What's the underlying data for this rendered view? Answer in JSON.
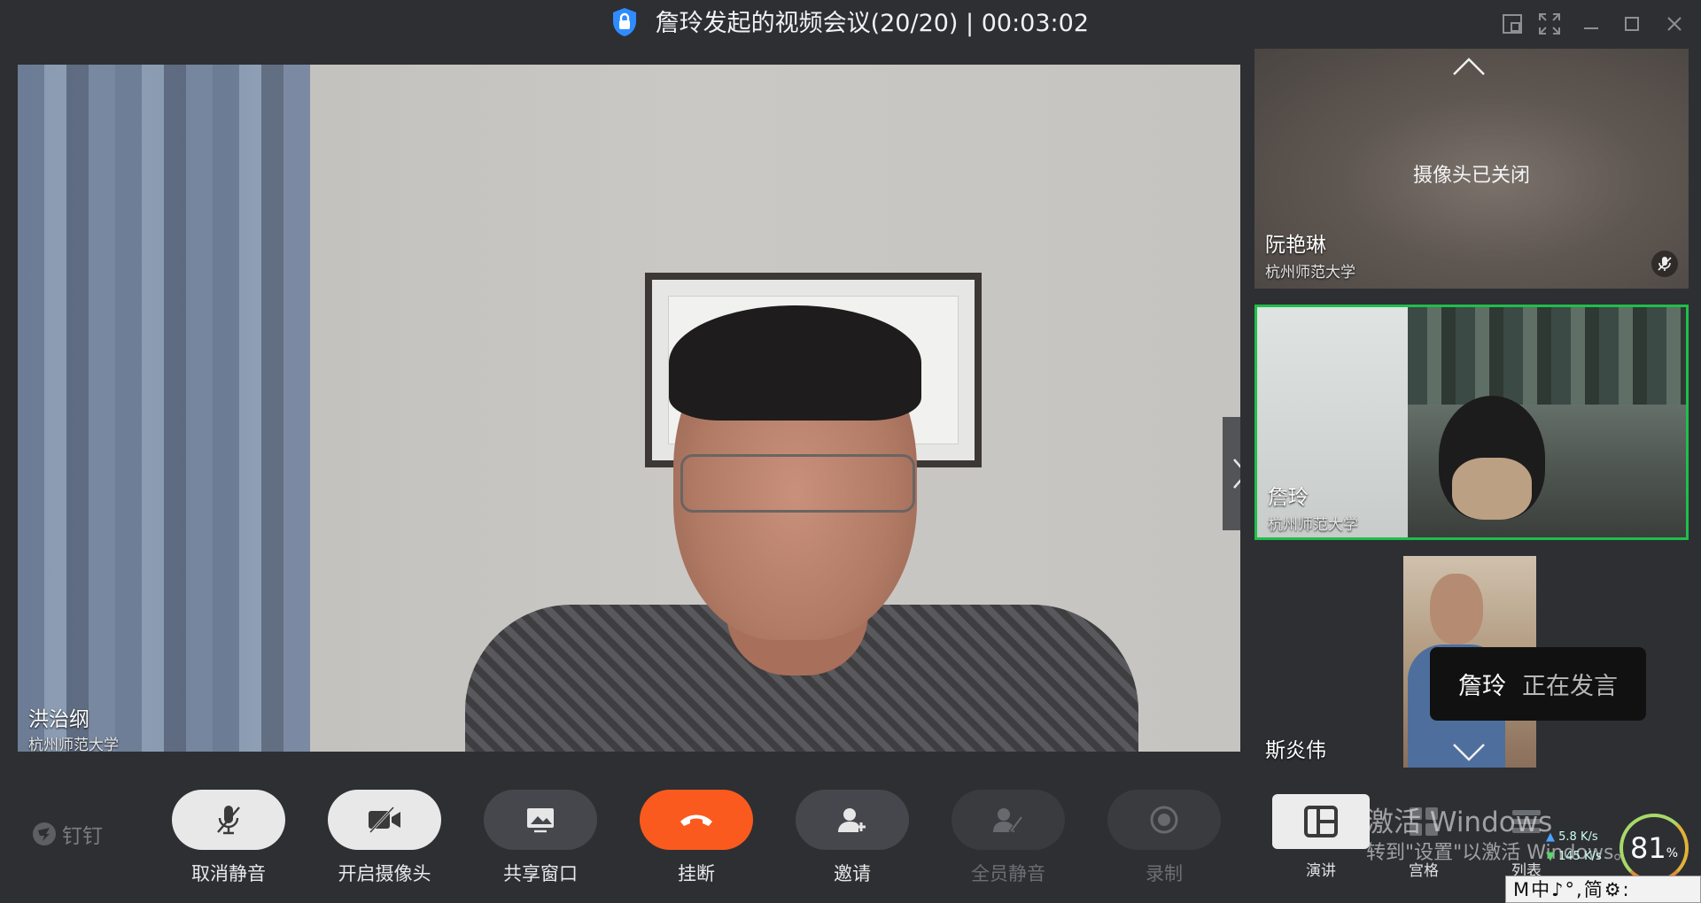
{
  "window": {
    "title": "詹玲发起的视频会议(20/20) | 00:03:02"
  },
  "main_video": {
    "name": "洪治纲",
    "org": "杭州师范大学"
  },
  "participants": [
    {
      "name": "阮艳琳",
      "org": "杭州师范大学",
      "camera_status": "摄像头已关闭",
      "mic_muted": true
    },
    {
      "name": "詹玲",
      "org": "杭州师范大学",
      "highlighted": true
    },
    {
      "name": "斯炎伟"
    }
  ],
  "toast": {
    "speaker": "詹玲",
    "status": "正在发言"
  },
  "toolbar": {
    "logo_text": "钉钉",
    "buttons": [
      {
        "label": "取消静音",
        "icon": "mic-off-icon"
      },
      {
        "label": "开启摄像头",
        "icon": "camera-off-icon"
      },
      {
        "label": "共享窗口",
        "icon": "share-window-icon"
      },
      {
        "label": "挂断",
        "icon": "hangup-icon"
      },
      {
        "label": "邀请",
        "icon": "invite-icon"
      },
      {
        "label": "全员静音",
        "icon": "mute-all-icon",
        "disabled": true
      },
      {
        "label": "录制",
        "icon": "record-icon",
        "disabled": true
      }
    ],
    "layout_buttons": [
      {
        "label": "演讲",
        "selected": true
      },
      {
        "label": "宫格"
      },
      {
        "label": "列表"
      }
    ]
  },
  "overlay": {
    "activate_title": "激活 Windows",
    "activate_sub": "转到\"设置\"以激活 Windows。",
    "net_up": "5.8",
    "net_up_unit": "K/s",
    "net_down": "145",
    "net_down_unit": "K/s",
    "cpu_percent": "81",
    "cpu_unit": "%",
    "ime_text": "M中♪°,简⚙:"
  },
  "colors": {
    "accent_green": "#1fbf4a",
    "hangup_red": "#fa5a1e",
    "toolbar_bg": "#2d2f33"
  }
}
